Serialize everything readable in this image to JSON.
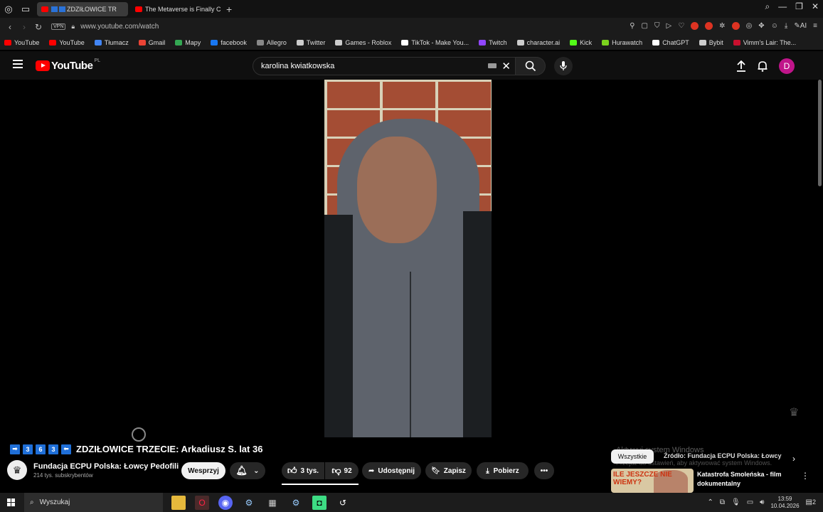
{
  "browser": {
    "tabs": [
      {
        "label": "ZDZIŁOWICE TR",
        "active": true
      },
      {
        "label": "The Metaverse is Finally C",
        "active": false
      }
    ],
    "url": "www.youtube.com/watch",
    "vpn_label": "VPN"
  },
  "bookmarks": [
    {
      "label": "YouTube",
      "color": "#ff0000"
    },
    {
      "label": "YouTube",
      "color": "#ff0000"
    },
    {
      "label": "Tłumacz",
      "color": "#4285f4"
    },
    {
      "label": "Gmail",
      "color": "#ea4335"
    },
    {
      "label": "Mapy",
      "color": "#34a853"
    },
    {
      "label": "facebook",
      "color": "#1877f2"
    },
    {
      "label": "Allegro",
      "color": "#888888"
    },
    {
      "label": "Twitter",
      "color": "#cccccc"
    },
    {
      "label": "Games - Roblox",
      "color": "#cccccc"
    },
    {
      "label": "TikTok - Make You...",
      "color": "#ffffff"
    },
    {
      "label": "Twitch",
      "color": "#9146ff"
    },
    {
      "label": "character.ai",
      "color": "#cccccc"
    },
    {
      "label": "Kick",
      "color": "#53fc18"
    },
    {
      "label": "Hurawatch",
      "color": "#7bd21e"
    },
    {
      "label": "ChatGPT",
      "color": "#ffffff"
    },
    {
      "label": "Bybit",
      "color": "#cccccc"
    },
    {
      "label": "Vimm's Lair: The...",
      "color": "#c8102e"
    }
  ],
  "youtube": {
    "logo_text": "YouTube",
    "region": "PL",
    "search_value": "karolina kwiatkowska",
    "avatar_letter": "D"
  },
  "video": {
    "title": "ZDZIŁOWICE TRZECIE: Arkadiusz S. lat 36",
    "title_prefix_boxes": [
      "➡",
      "3",
      "6",
      "3",
      "⬅"
    ],
    "channel_name": "Fundacja ECPU Polska: Łowcy Pedofili",
    "channel_subs": "214 tys. subskrybentów",
    "support_label": "Wesprzyj",
    "likes": "3 tys.",
    "dislikes": "92",
    "share_label": "Udostępnij",
    "save_label": "Zapisz",
    "download_label": "Pobierz"
  },
  "sidebar": {
    "chip_all": "Wszystkie",
    "chip_source": "Źródło: Fundacja ECPU Polska: Łowcy",
    "rec_title": "Katastrofa Smoleńska - film dokumentalny",
    "rec_thumb_text": "ILE JESZCZE NIE WIEMY?"
  },
  "windows_watermark": {
    "line1": "Aktywuj system Windows",
    "line2": "Przejdź do ustawień, aby aktywować system Windows."
  },
  "taskbar": {
    "search_placeholder": "Wyszukaj",
    "time": "13:59",
    "date": "10.04.2026",
    "notifications": "2"
  }
}
